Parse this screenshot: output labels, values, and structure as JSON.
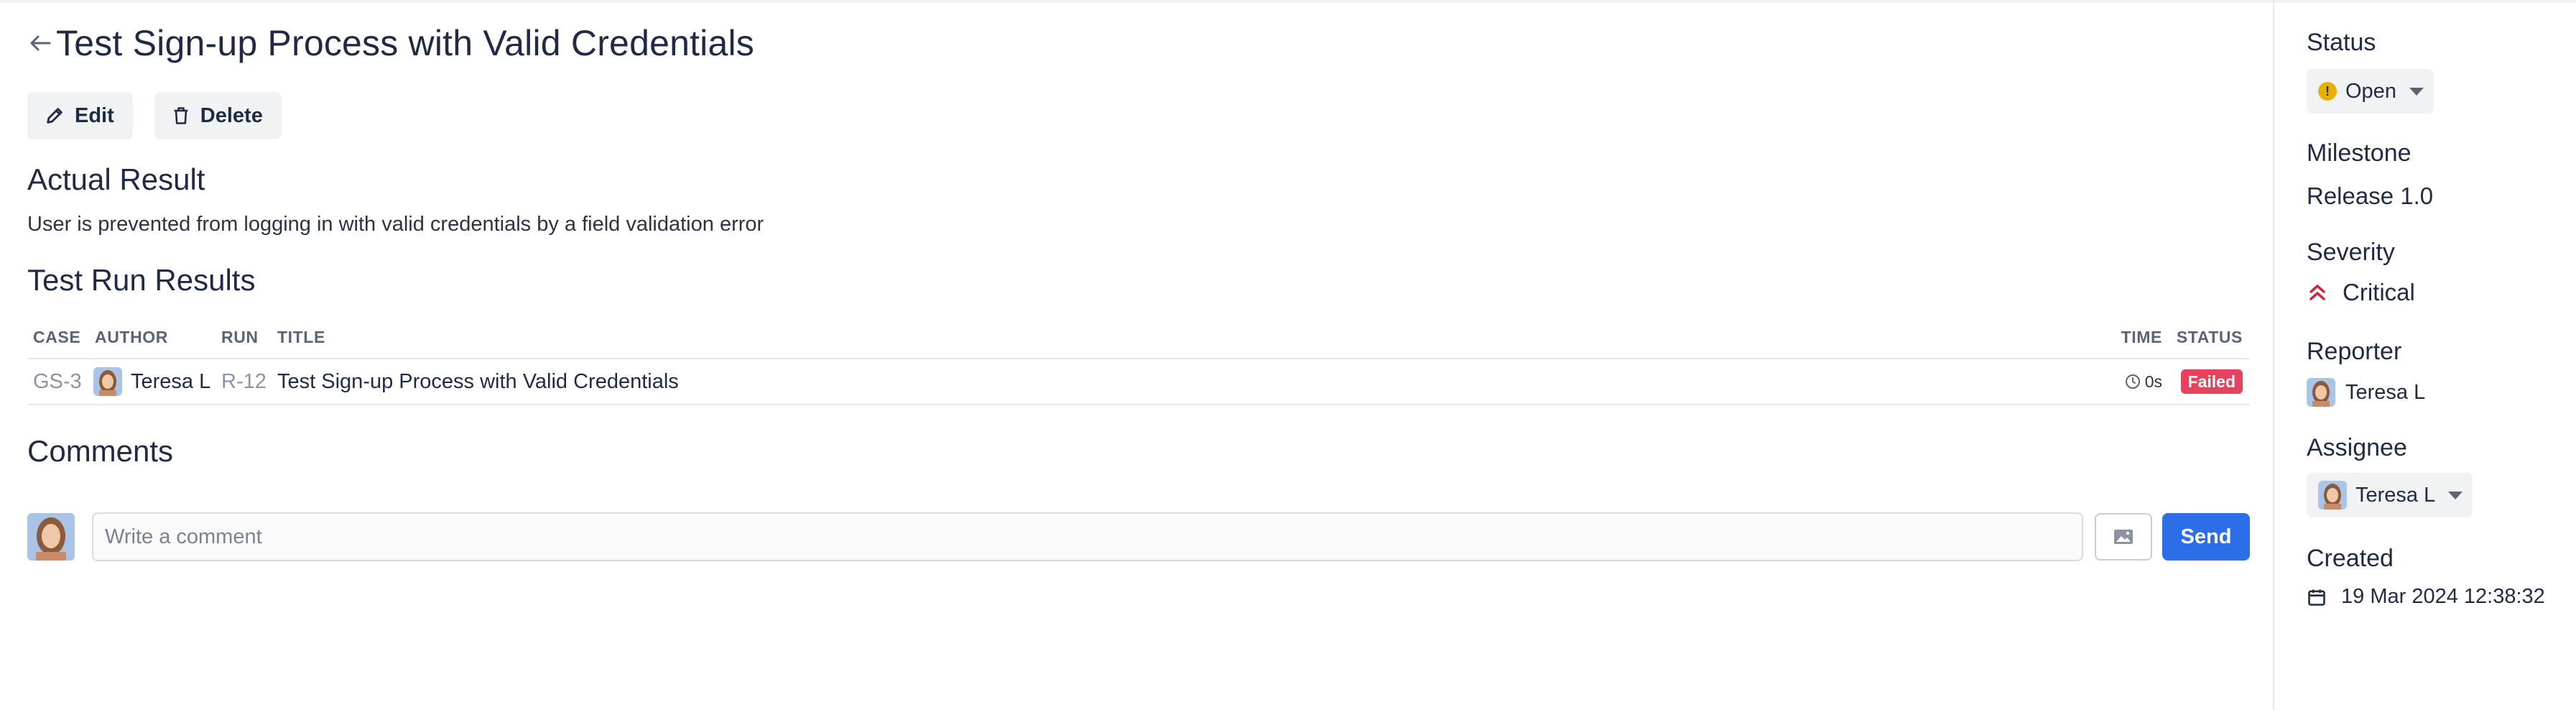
{
  "header": {
    "title": "Test Sign-up Process with Valid Credentials",
    "back_icon": "arrow-left-icon"
  },
  "actions": {
    "edit_label": "Edit",
    "delete_label": "Delete"
  },
  "actual_result": {
    "heading": "Actual Result",
    "text": "User is prevented from logging in with valid credentials by a field validation error"
  },
  "test_run_results": {
    "heading": "Test Run Results",
    "columns": [
      "CASE",
      "AUTHOR",
      "RUN",
      "TITLE",
      "TIME",
      "STATUS"
    ],
    "rows": [
      {
        "case": "GS-3",
        "author": "Teresa L",
        "run": "R-12",
        "title": "Test Sign-up Process with Valid Credentials",
        "time": "0s",
        "status": "Failed"
      }
    ]
  },
  "comments": {
    "heading": "Comments",
    "placeholder": "Write a comment",
    "send_label": "Send"
  },
  "sidebar": {
    "status_label": "Status",
    "status_value": "Open",
    "milestone_label": "Milestone",
    "milestone_value": "Release 1.0",
    "severity_label": "Severity",
    "severity_value": "Critical",
    "reporter_label": "Reporter",
    "reporter_value": "Teresa L",
    "assignee_label": "Assignee",
    "assignee_value": "Teresa L",
    "created_label": "Created",
    "created_value": "19 Mar 2024 12:38:32"
  },
  "colors": {
    "accent": "#2b6ee8",
    "failed": "#e5435d",
    "open_status": "#e6b000",
    "critical": "#d61f3a",
    "text": "#1f2a44"
  }
}
